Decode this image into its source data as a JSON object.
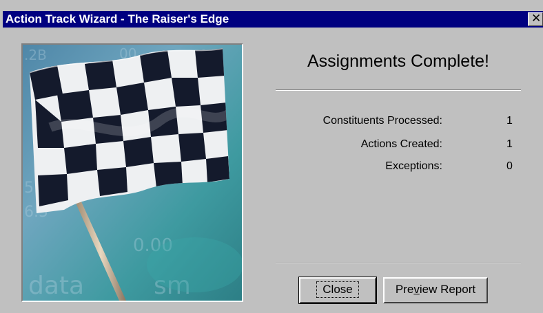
{
  "window": {
    "title": "Action Track Wizard - The Raiser's Edge",
    "close_glyph": "✕"
  },
  "image": {
    "description_icon": "checkered-flag-icon",
    "digits": [
      ".2B",
      "00",
      ".99",
      "5.5",
      "6.5",
      "0.00",
      "data",
      "sm"
    ]
  },
  "main": {
    "heading": "Assignments Complete!",
    "stats": [
      {
        "label": "Constituents Processed:",
        "value": "1"
      },
      {
        "label": "Actions Created:",
        "value": "1"
      },
      {
        "label": "Exceptions:",
        "value": "0"
      }
    ]
  },
  "buttons": {
    "close_label": "Close",
    "preview_prefix": "Pre",
    "preview_mnemonic": "v",
    "preview_suffix": "iew Report"
  },
  "colors": {
    "titlebar": "#000080",
    "window_bg": "#c0c0c0"
  }
}
